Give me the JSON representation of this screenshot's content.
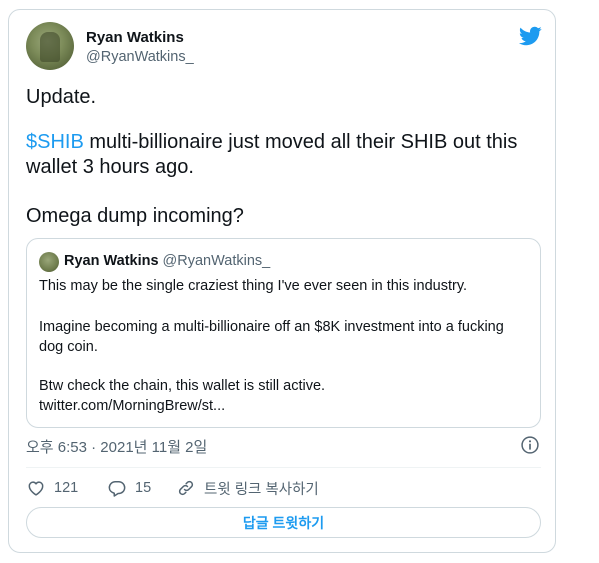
{
  "author": {
    "name": "Ryan Watkins",
    "handle": "@RyanWatkins_"
  },
  "tweet": {
    "line1": "Update.",
    "cashtag": "$SHIB",
    "line2_rest": " multi-billionaire just moved all their SHIB out this",
    "line3": "wallet 3 hours ago.",
    "line4": "Omega dump incoming?"
  },
  "quote": {
    "name": "Ryan Watkins",
    "handle": "@RyanWatkins_",
    "line1": "This may be the single craziest thing I've ever seen in this industry.",
    "line2": "Imagine becoming a multi-billionaire off an $8K investment into a fucking",
    "line3": "dog coin.",
    "line4": "Btw check the chain, this wallet is still active.",
    "link": "twitter.com/MorningBrew/st..."
  },
  "timestamp": "오후 6:53 · 2021년 11월 2일",
  "actions": {
    "likes": "121",
    "replies": "15",
    "copy_link": "트윗 링크 복사하기"
  },
  "reply_button": "답글 트윗하기",
  "colors": {
    "accent": "#1d9bf0",
    "text": "#0f1419",
    "muted": "#536471",
    "border": "#cfd9de"
  },
  "icons": [
    "twitter-bird-icon",
    "info-icon",
    "heart-icon",
    "reply-icon",
    "link-icon"
  ]
}
